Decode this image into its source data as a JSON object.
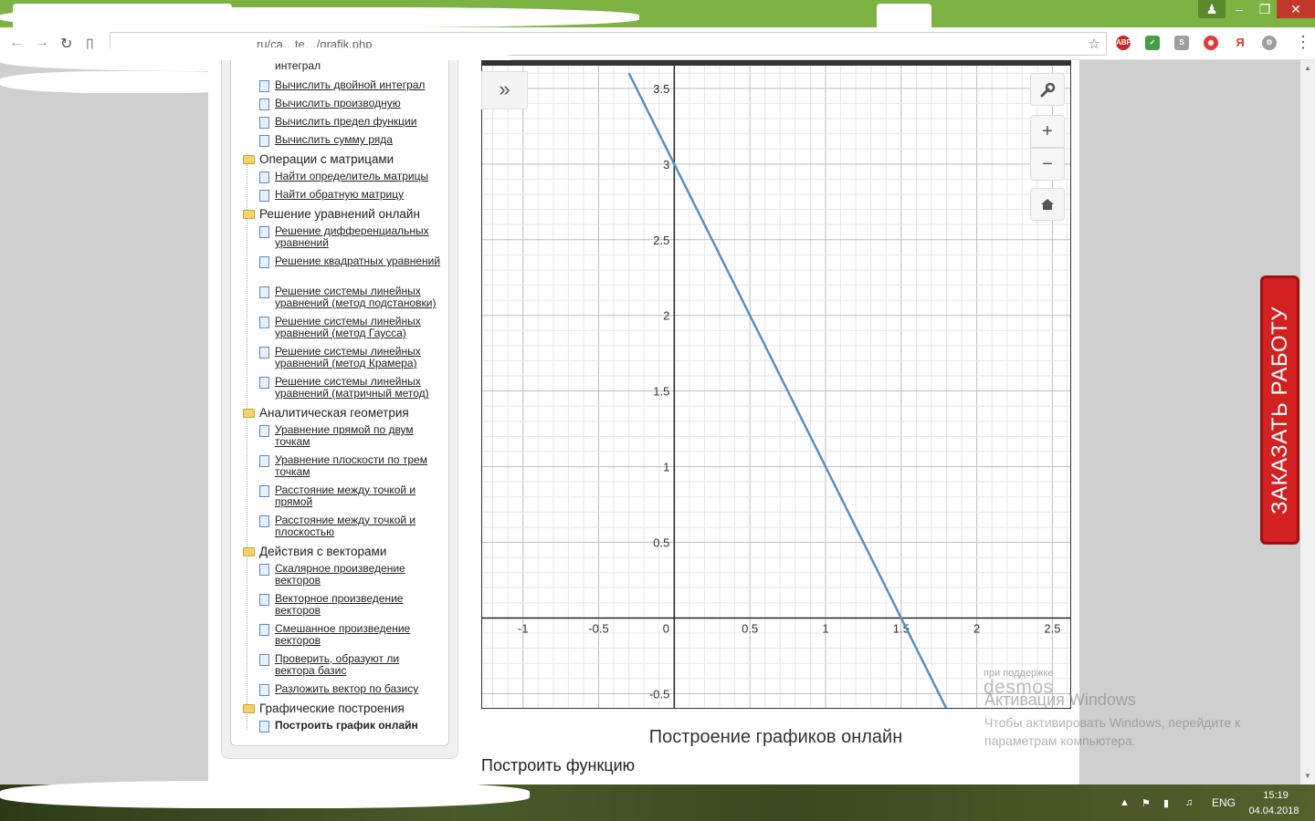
{
  "browser": {
    "address_text": "ru/ca…te…/grafik.php",
    "menu_icon": "⋮"
  },
  "sidebar": {
    "categories": [
      {
        "label": "Операции с матрицами"
      },
      {
        "label": "Решение уравнений онлайн"
      },
      {
        "label": "Аналитическая геометрия"
      },
      {
        "label": "Действия с векторами"
      },
      {
        "label": "Графические построения"
      }
    ],
    "items": [
      "интеграл",
      "Вычислить двойной интеграл",
      "Вычислить производную",
      "Вычислить предел функции",
      "Вычислить сумму ряда",
      "Найти определитель матрицы",
      "Найти обратную матрицу",
      "Решение дифференциальных уравнений",
      "Решение квадратных уравнений",
      "Решение системы линейных уравнений (метод подстановки)",
      "Решение системы линейных уравнений (метод Гаусса)",
      "Решение системы линейных уравнений (метод Крамера)",
      "Решение системы линейных уравнений (матричный метод)",
      "Уравнение прямой по двум точкам",
      "Уравнение плоскости по трем точкам",
      "Расстояние между точкой и прямой",
      "Расстояние между точкой и плоскостью",
      "Скалярное произведение векторов",
      "Векторное произведение векторов",
      "Смешанное произведение векторов",
      "Проверить, образуют ли вектора базис",
      "Разложить вектор по базису",
      "Построить график онлайн"
    ]
  },
  "graph": {
    "powered_by": "при поддержке",
    "logo": "desmos",
    "expand_icon": "»",
    "zoom_in": "+",
    "zoom_out": "−"
  },
  "chart_data": {
    "type": "line",
    "series": [
      {
        "x": [
          -0.3,
          1.8
        ],
        "y": [
          3.6,
          -0.6
        ]
      }
    ],
    "xlim": [
      -1.27,
      2.63
    ],
    "ylim": [
      -0.6,
      3.65
    ],
    "x_ticks": [
      "-1",
      "-0.5",
      "0",
      "0.5",
      "1",
      "1.5",
      "2",
      "2.5"
    ],
    "y_ticks": [
      "3.5",
      "3",
      "2.5",
      "2",
      "1.5",
      "1",
      "0.5",
      "-0.5"
    ],
    "line_color": "#5a8ec4",
    "grid": true
  },
  "content": {
    "graph_title": "Построение графиков онлайн",
    "build_function": "Построить функцию"
  },
  "order_button": "ЗАКАЗАТЬ РАБОТУ",
  "watermark": {
    "title": "Активация Windows",
    "subtitle": "Чтобы активировать Windows, перейдите к параметрам компьютера."
  },
  "taskbar": {
    "lang": "ENG",
    "time": "15:19",
    "date": "04.04.2018"
  }
}
